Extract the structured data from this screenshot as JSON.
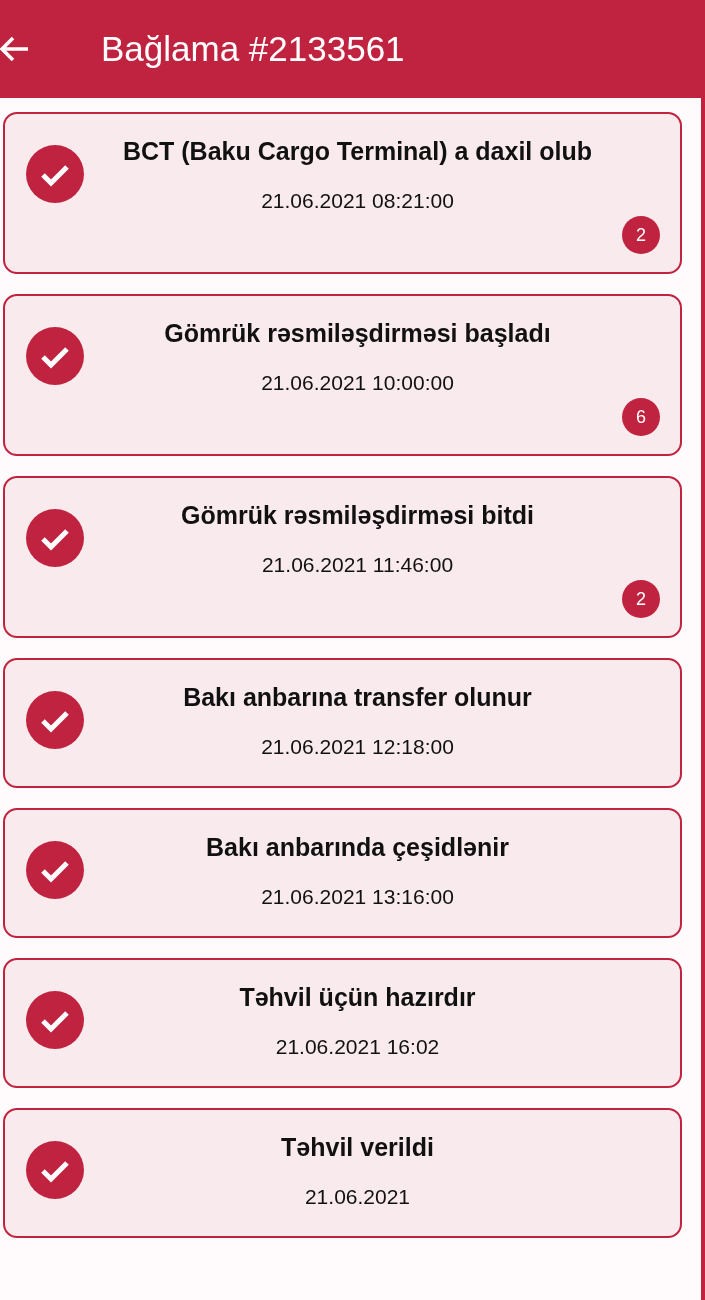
{
  "header": {
    "title": "Bağlama #2133561"
  },
  "events": [
    {
      "title": "BCT (Baku Cargo Terminal) a daxil olub",
      "date": "21.06.2021 08:21:00",
      "done": true,
      "count": "2"
    },
    {
      "title": "Gömrük rəsmiləşdirməsi başladı",
      "date": "21.06.2021 10:00:00",
      "done": true,
      "count": "6"
    },
    {
      "title": "Gömrük rəsmiləşdirməsi bitdi",
      "date": "21.06.2021 11:46:00",
      "done": true,
      "count": "2"
    },
    {
      "title": "Bakı anbarına transfer olunur",
      "date": "21.06.2021 12:18:00",
      "done": true
    },
    {
      "title": "Bakı anbarında çeşidlənir",
      "date": "21.06.2021 13:16:00",
      "done": true
    },
    {
      "title": "Təhvil üçün hazırdır",
      "date": "21.06.2021 16:02",
      "done": true
    },
    {
      "title": "Təhvil verildi",
      "date": "21.06.2021",
      "done": true
    }
  ]
}
